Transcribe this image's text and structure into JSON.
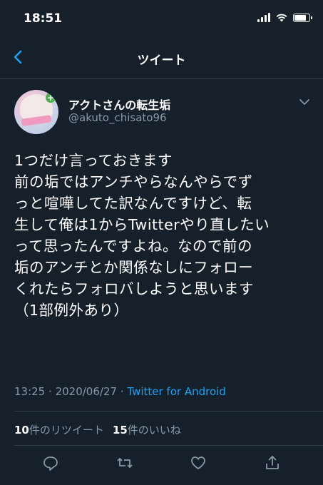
{
  "status_bar": {
    "time": "18:51",
    "battery_level": 0.85
  },
  "header": {
    "title": "ツイート",
    "back_icon": "chevron-left-icon"
  },
  "tweet": {
    "display_name": "アクトさんの転生垢",
    "handle": "@akuto_chisato96",
    "text_lines": [
      "1つだけ言っておきます",
      "前の垢ではアンチやらなんやらでず",
      "っと喧嘩してた訳なんですけど、転",
      "生して俺は1からTwitterやり直したい",
      "って思ったんですよね。なので前の",
      "垢のアンチとか関係なしにフォロー",
      "くれたらフォロバしようと思います",
      "（1部例外あり）"
    ],
    "time": "13:25",
    "separator": "·",
    "date": "2020/06/27",
    "source": "Twitter for Android"
  },
  "stats": {
    "retweets_count": "10",
    "retweets_label": "件のリツイート",
    "likes_count": "15",
    "likes_label": "件のいいね"
  },
  "actions": [
    "reply-icon",
    "retweet-icon",
    "like-icon",
    "share-icon"
  ],
  "colors": {
    "background": "#15202b",
    "secondary_text": "#8899a6",
    "accent": "#1da1f2",
    "divider": "#2f3d4c"
  }
}
